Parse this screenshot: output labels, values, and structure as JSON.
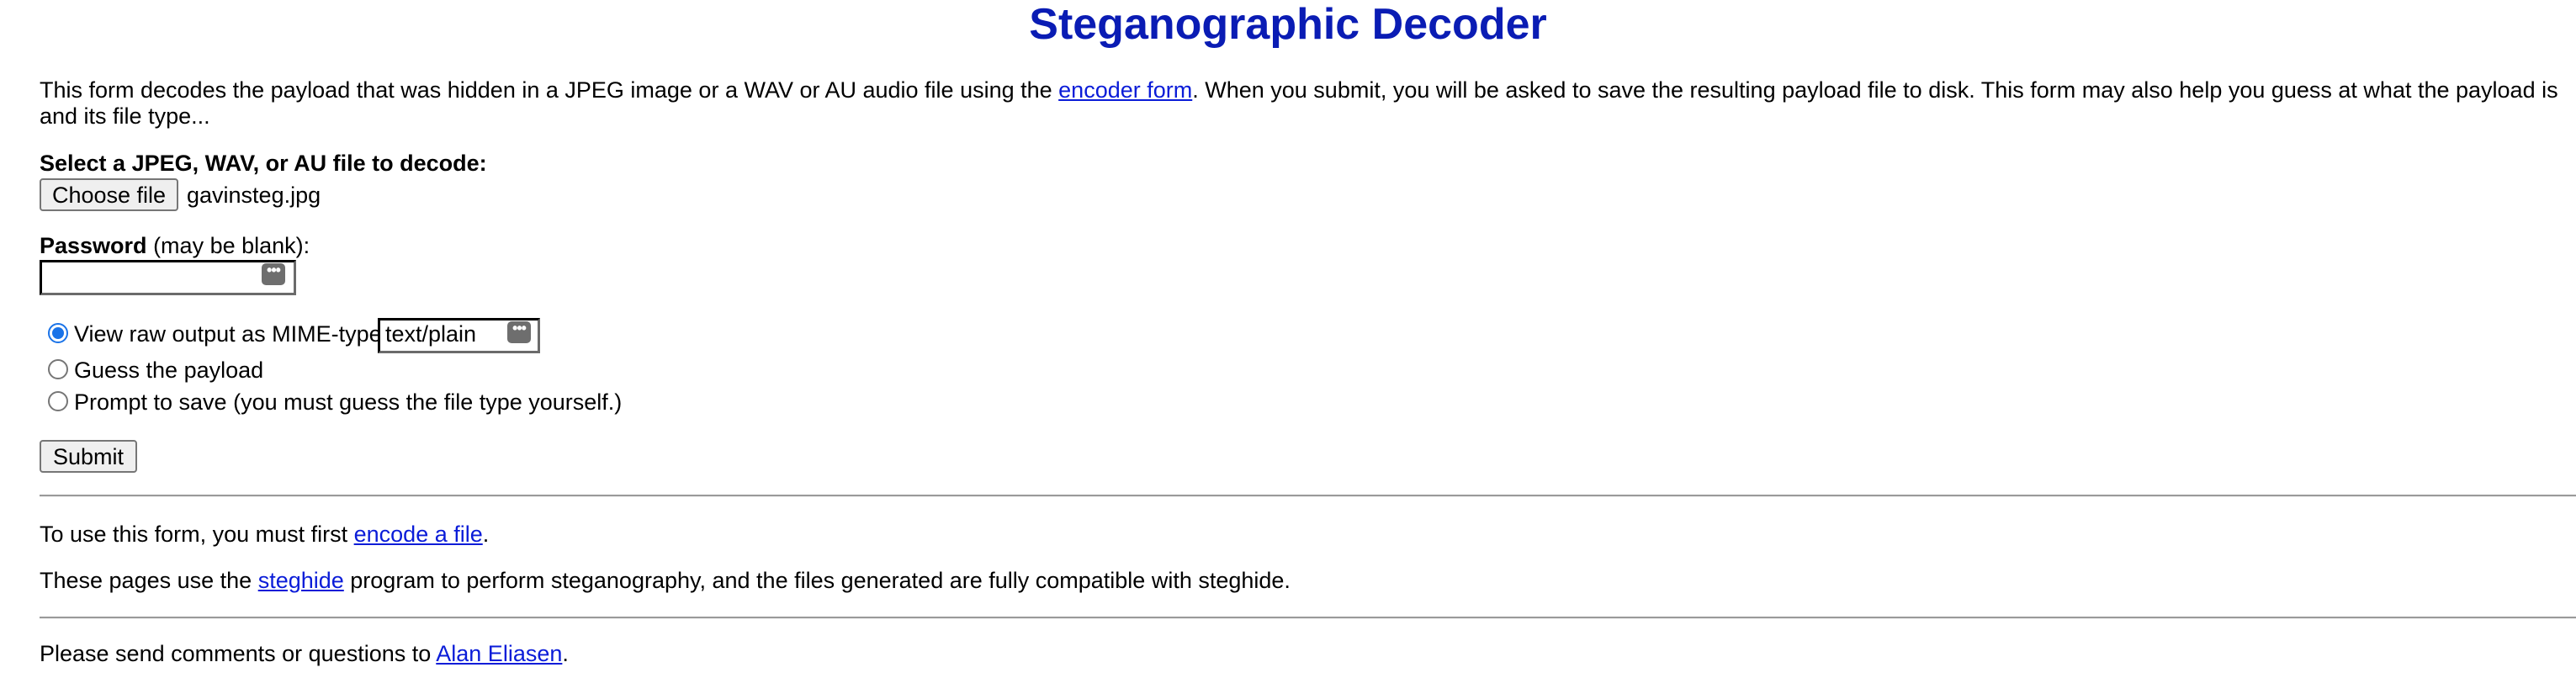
{
  "page": {
    "title": "Steganographic Decoder"
  },
  "intro": {
    "before_link": "This form decodes the payload that was hidden in a JPEG image or a WAV or AU audio file using the ",
    "link_text": "encoder form",
    "after_link": ". When you submit, you will be asked to save the resulting payload file to disk. This form may also help you guess at what the payload is and its file type..."
  },
  "file_field": {
    "label": "Select a JPEG, WAV, or AU file to decode:",
    "button_label": "Choose file",
    "file_name": "gavinsteg.jpg"
  },
  "password_field": {
    "label_bold": "Password",
    "label_rest": " (may be blank):",
    "value": "",
    "key_icon_glyph": "•••"
  },
  "output_options": [
    {
      "label": "View raw output as MIME-type",
      "checked": true
    },
    {
      "label": "Guess the payload",
      "checked": false
    },
    {
      "label": "Prompt to save (you must guess the file type yourself.)",
      "checked": false
    }
  ],
  "mime_field": {
    "value": "text/plain",
    "key_icon_glyph": "•••"
  },
  "submit": {
    "label": "Submit"
  },
  "footer": {
    "encode_before": "To use this form, you must first ",
    "encode_link": "encode a file",
    "encode_after": ".",
    "steghide_before": "These pages use the ",
    "steghide_link": "steghide",
    "steghide_after": " program to perform steganography, and the files generated are fully compatible with steghide.",
    "contact_before": "Please send comments or questions to ",
    "contact_link": "Alan Eliasen",
    "contact_after": "."
  },
  "colors": {
    "title": "#0a1cb4",
    "link": "#0a1cd8",
    "radio_accent": "#1a73e8"
  },
  "icons": {
    "password_reveal": "key-icon",
    "radio_selected": "radio-checked-icon"
  }
}
